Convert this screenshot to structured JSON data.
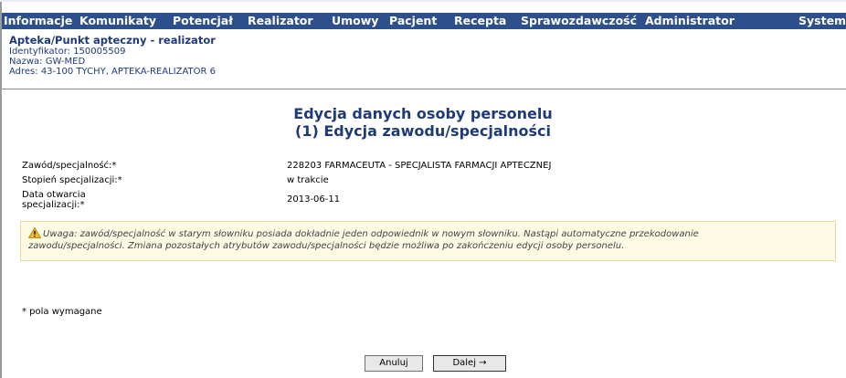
{
  "menu": {
    "items": [
      "Informacje",
      "Komunikaty",
      "Potencjał",
      "Realizator",
      "Umowy",
      "Pacjent",
      "Recepta",
      "Sprawozdawczość",
      "Administrator",
      "System"
    ]
  },
  "header": {
    "title": "Apteka/Punkt apteczny - realizator",
    "identifier": "Identyfikator: 150005509",
    "name": "Nazwa: GW-MED",
    "address": "Adres: 43-100 TYCHY, APTEKA-REALIZATOR 6"
  },
  "page": {
    "title_line1": "Edycja danych osoby personelu",
    "title_line2": "(1) Edycja zawodu/specjalności"
  },
  "form": {
    "profession_label": "Zawód/specjalność:*",
    "profession_value": "228203 FARMACEUTA - SPECJALISTA FARMACJI APTECZNEJ",
    "degree_label": "Stopień specjalizacji:*",
    "degree_value": "w trakcie",
    "opening_date_label_line1": "Data otwarcia",
    "opening_date_label_line2": "specjalizacji:*",
    "opening_date_value": "2013-06-11"
  },
  "warning": {
    "icon": "warning-triangle-icon",
    "line1": "Uwaga: zawód/specjalność w starym słowniku posiada dokładnie jeden odpowiednik w nowym słowniku. Nastąpi automatyczne przekodowanie",
    "line2": "zawodu/specjalności. Zmiana pozostałych atrybutów zawodu/specjalności będzie możliwa po zakończeniu edycji osoby personelu."
  },
  "footer": {
    "required_note": "* pola wymagane",
    "cancel_label": "Anuluj",
    "next_label": "Dalej →"
  },
  "colors": {
    "menubar": "#2d4f8c",
    "heading": "#1f3a78",
    "warning_bg": "#fdfbe4"
  }
}
